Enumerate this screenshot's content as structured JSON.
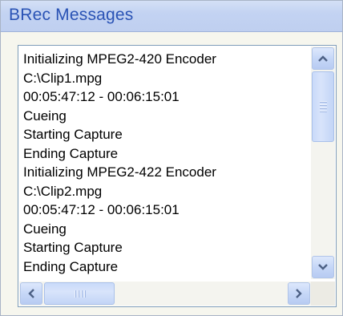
{
  "window": {
    "title": "BRec Messages"
  },
  "messages": [
    "Initializing MPEG2-420 Encoder",
    "C:\\Clip1.mpg",
    "00:05:47:12 - 00:06:15:01",
    "Cueing",
    "Starting Capture",
    "Ending Capture",
    "Initializing MPEG2-422 Encoder",
    "C:\\Clip2.mpg",
    "00:05:47:12 - 00:06:15:01",
    "Cueing",
    "Starting Capture",
    "Ending Capture"
  ],
  "icons": {
    "scroll_up": "chevron-up-icon",
    "scroll_down": "chevron-down-icon",
    "scroll_left": "chevron-left-icon",
    "scroll_right": "chevron-right-icon"
  },
  "colors": {
    "title_text": "#2a53b5",
    "title_bar": "#c3d3f2",
    "list_border": "#7f9db9",
    "arrow": "#4d6185"
  },
  "scroll": {
    "vertical_position": 0.0,
    "horizontal_position": 0.0
  }
}
